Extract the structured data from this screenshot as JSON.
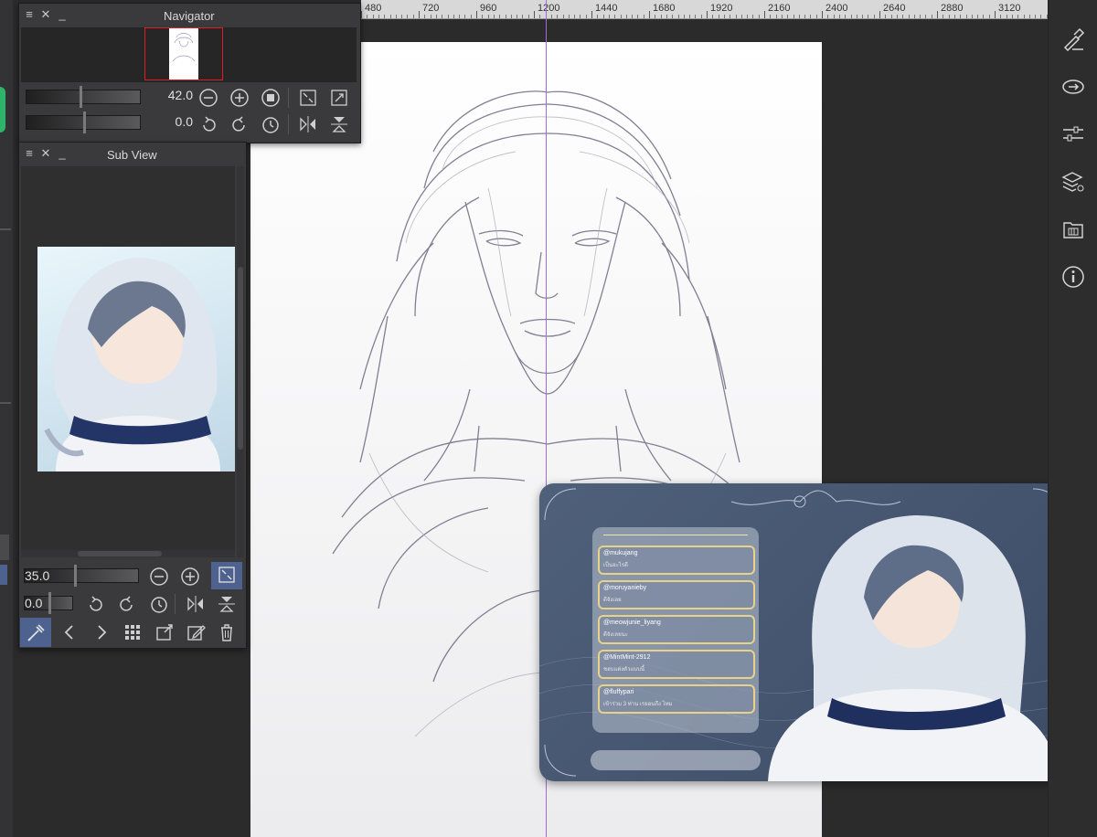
{
  "ruler": {
    "labels": [
      "480",
      "720",
      "960",
      "1200",
      "1440",
      "1680",
      "1920",
      "2160",
      "2400",
      "2640",
      "2880",
      "3120"
    ]
  },
  "navigator": {
    "title": "Navigator",
    "zoom_value": "42.0",
    "rotate_value": "0.0"
  },
  "subview": {
    "title": "Sub View",
    "zoom_value": "35.0",
    "rotate_value": "0.0"
  },
  "chat_card": {
    "comments": [
      {
        "user": "@mukujang",
        "text": "เป็นอะไรดี"
      },
      {
        "user": "@moruyanieby",
        "text": "ดีจังเลย"
      },
      {
        "user": "@meowjunie_liyang",
        "text": "ดีจังเลยนะ"
      },
      {
        "user": "@MintMint-2912",
        "text": "ชอบแต่งตัวแบบนี้"
      },
      {
        "user": "@fluffypari",
        "text": "เข้าร่วม 3 ท่าน เรยอนถึง ไหม"
      }
    ]
  },
  "right_toolbar": {
    "icons": [
      "brush-settings-icon",
      "sync-icon",
      "adjust-sliders-icon",
      "layers-icon",
      "gallery-icon",
      "info-icon"
    ]
  },
  "colors": {
    "workspace": "#2b2b2c",
    "panel": "#3a3a3c",
    "guide": "#9b6fd6",
    "card_bg": "#4a5a72",
    "card_gold": "#e8d28a"
  }
}
